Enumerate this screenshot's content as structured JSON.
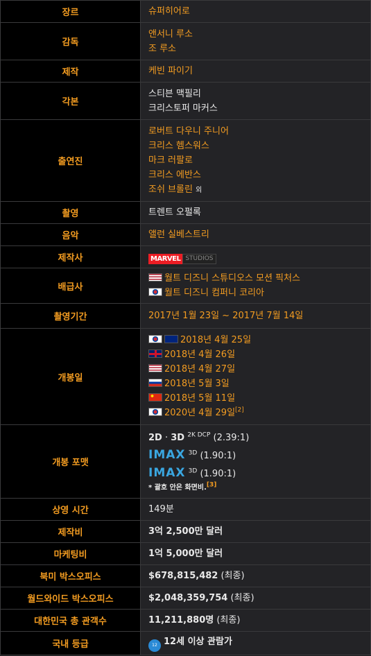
{
  "rows": {
    "genre": {
      "label": "장르",
      "value": "슈퍼히어로"
    },
    "director": {
      "label": "감독",
      "values": [
        "앤서니 루소",
        "조 루소"
      ]
    },
    "producer": {
      "label": "제작",
      "value": "케빈 파이기"
    },
    "screenplay": {
      "label": "각본",
      "values": [
        "스티븐 맥필리",
        "크리스토퍼 마커스"
      ]
    },
    "cast": {
      "label": "출연진",
      "values": [
        "로버트 다우니 주니어",
        "크리스 헴스워스",
        "마크 러팔로",
        "크리스 에반스",
        "조쉬 브롤린"
      ],
      "suffix": "외"
    },
    "cinematography": {
      "label": "촬영",
      "value": "트렌트 오펄록"
    },
    "music": {
      "label": "음악",
      "value": "앨런 실베스트리"
    },
    "studio": {
      "label": "제작사",
      "logo_text": "MARVEL",
      "logo_sub": "STUDIOS"
    },
    "distributor": {
      "label": "배급사",
      "values": [
        {
          "flag": "us",
          "text": "월트 디즈니 스튜디오스 모션 픽처스"
        },
        {
          "flag": "kr",
          "text": "월트 디즈니 컴퍼니 코리아"
        }
      ]
    },
    "filming_period": {
      "label": "촬영기간",
      "value": "2017년 1월 23일 ~ 2017년 7월 14일"
    },
    "release": {
      "label": "개봉일",
      "values": [
        {
          "flags": [
            "kr",
            "au"
          ],
          "text": "2018년 4월 25일"
        },
        {
          "flags": [
            "gb"
          ],
          "text": "2018년 4월 26일"
        },
        {
          "flags": [
            "us"
          ],
          "text": "2018년 4월 27일"
        },
        {
          "flags": [
            "ru"
          ],
          "text": "2018년 5월 3일"
        },
        {
          "flags": [
            "cn"
          ],
          "text": "2018년 5월 11일"
        },
        {
          "flags": [
            "kr"
          ],
          "text": "2020년 4월 29일",
          "ref": "[2]"
        }
      ]
    },
    "format": {
      "label": "개봉 포맷",
      "line1": {
        "a": "2D",
        "sep": "·",
        "b": "3D",
        "sup": "2K DCP",
        "ratio": "(2.39:1)"
      },
      "imax1": {
        "logo": "IMAX",
        "sup": "3D",
        "ratio": "(1.90:1)"
      },
      "imax2": {
        "logo": "IMAX",
        "sup": "3D",
        "ratio": "(1.90:1)"
      },
      "note": "* 괄호 안은 화면비.",
      "note_ref": "[3]"
    },
    "runtime": {
      "label": "상영 시간",
      "value": "149분"
    },
    "budget": {
      "label": "제작비",
      "value": "3억 2,500만 달러"
    },
    "marketing": {
      "label": "마케팅비",
      "value": "1억 5,000만 달러"
    },
    "na_box": {
      "label": "북미 박스오피스",
      "value": "$678,815,482",
      "suffix": "(최종)"
    },
    "ww_box": {
      "label": "월드와이드 박스오피스",
      "value": "$2,048,359,754",
      "suffix": "(최종)"
    },
    "kr_audience": {
      "label": "대한민국 총 관객수",
      "value": "11,211,880명",
      "suffix": "(최종)"
    },
    "rating": {
      "label": "국내 등급",
      "badge": "12",
      "value": "12세 이상 관람가"
    }
  }
}
